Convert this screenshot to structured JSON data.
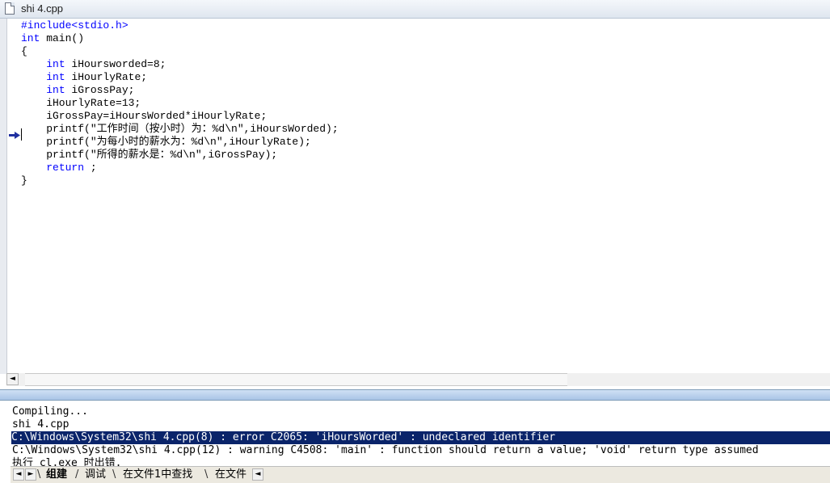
{
  "window": {
    "title": "shi 4.cpp",
    "icon": "document-icon"
  },
  "editor": {
    "code_lines": [
      [
        {
          "t": "#include<stdio.h>",
          "c": "kw"
        }
      ],
      [
        {
          "t": "int",
          "c": "kw"
        },
        {
          "t": " main()"
        }
      ],
      [
        {
          "t": "{"
        }
      ],
      [
        {
          "t": "    "
        },
        {
          "t": "int",
          "c": "kw"
        },
        {
          "t": " iHoursworded=8;"
        }
      ],
      [
        {
          "t": "    "
        },
        {
          "t": "int",
          "c": "kw"
        },
        {
          "t": " iHourlyRate;"
        }
      ],
      [
        {
          "t": "    "
        },
        {
          "t": "int",
          "c": "kw"
        },
        {
          "t": " iGrossPay;"
        }
      ],
      [
        {
          "t": "    iHourlyRate=13;"
        }
      ],
      [
        {
          "t": "    iGrossPay=iHoursWorded*iHourlyRate;"
        }
      ],
      [
        {
          "t": "    printf(\"工作时间（按小时）为：%d\\n\",iHoursWorded);"
        }
      ],
      [
        {
          "t": "    printf(\"为每小时的薪水为：%d\\n\",iHourlyRate);"
        }
      ],
      [
        {
          "t": "    printf(\"所得的薪水是：%d\\n\",iGrossPay);"
        }
      ],
      [
        {
          "t": "    "
        },
        {
          "t": "return",
          "c": "kw"
        },
        {
          "t": " ;"
        }
      ],
      [
        {
          "t": "}"
        }
      ]
    ],
    "current_line_marker": "arrow-right-icon",
    "keyword_color": "#0000ff"
  },
  "scrollbar": {
    "left_btn": "◄",
    "right_btn": "►"
  },
  "output": {
    "lines": [
      "Compiling...",
      "shi 4.cpp",
      "C:\\Windows\\System32\\shi 4.cpp(8) : error C2065: 'iHoursWorded' : undeclared identifier",
      "C:\\Windows\\System32\\shi 4.cpp(12) : warning C4508: 'main' : function should return a value; 'void' return type assumed",
      "执行 cl.exe 时出错."
    ],
    "selected_index": 2,
    "selection_color": "#0a246a"
  },
  "tabs": {
    "nav_left": "◄",
    "nav_right": "►",
    "items": [
      "组建",
      "调试",
      "在文件1中查找",
      "在文件"
    ],
    "active_index": 0
  }
}
